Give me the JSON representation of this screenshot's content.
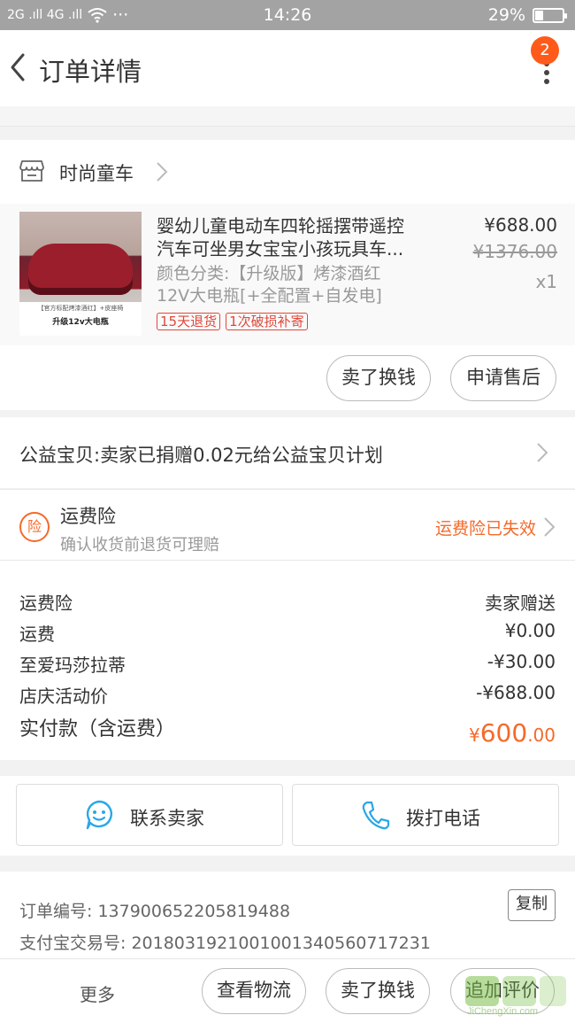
{
  "status_bar": {
    "signals": "2G .ıll 4G .ıll",
    "dots": "···",
    "time": "14:26",
    "battery": "29%",
    "battery_level": 0.29
  },
  "nav": {
    "title": "订单详情",
    "badge_count": "2"
  },
  "shop": {
    "name": "时尚童车"
  },
  "product": {
    "title_line1": "婴幼儿童电动车四轮摇摆带遥控",
    "title_line2": "汽车可坐男女宝宝小孩玩具车...",
    "sku_line1": "颜色分类:【升级版】烤漆酒红",
    "sku_line2": "12V大电瓶[+全配置+自发电]",
    "tags": [
      "15天退货",
      "1次破损补寄"
    ],
    "price": "¥688.00",
    "original_price": "¥1376.00",
    "quantity": "x1",
    "image_caption_top": "【官方标配烤漆酒红】+皮座椅",
    "image_caption_bottom": "升级12v大电瓶"
  },
  "item_actions": {
    "sell": "卖了换钱",
    "after_sale": "申请售后"
  },
  "charity": {
    "text": "公益宝贝:卖家已捐赠0.02元给公益宝贝计划"
  },
  "shipping_insurance": {
    "title": "运费险",
    "subtitle": "确认收货前退货可理赔",
    "status": "运费险已失效",
    "icon_text": "险"
  },
  "fees": {
    "rows": [
      {
        "label": "运费险",
        "value": "卖家赠送"
      },
      {
        "label": "运费",
        "value": "¥0.00"
      },
      {
        "label": "至爱玛莎拉蒂",
        "value": "-¥30.00"
      },
      {
        "label": "店庆活动价",
        "value": "-¥688.00"
      }
    ],
    "total_label": "实付款（含运费）",
    "total_currency": "¥",
    "total_int": "600",
    "total_dec": ".00"
  },
  "contact": {
    "seller": "联系卖家",
    "phone": "拨打电话"
  },
  "order_info": {
    "order_no": "订单编号: 137900652205819488",
    "alipay_no": "支付宝交易号: 2018031921001001340560717231",
    "copy": "复制"
  },
  "bottom_bar": {
    "more": "更多",
    "logistics": "查看物流",
    "sell": "卖了换钱",
    "review": "追加评价"
  },
  "watermark": "JiChengXin.com",
  "colors": {
    "accent": "#f46a2a",
    "tag_red": "#e0483a",
    "badge": "#ff5a1a",
    "icon_blue": "#2aa7e8"
  }
}
